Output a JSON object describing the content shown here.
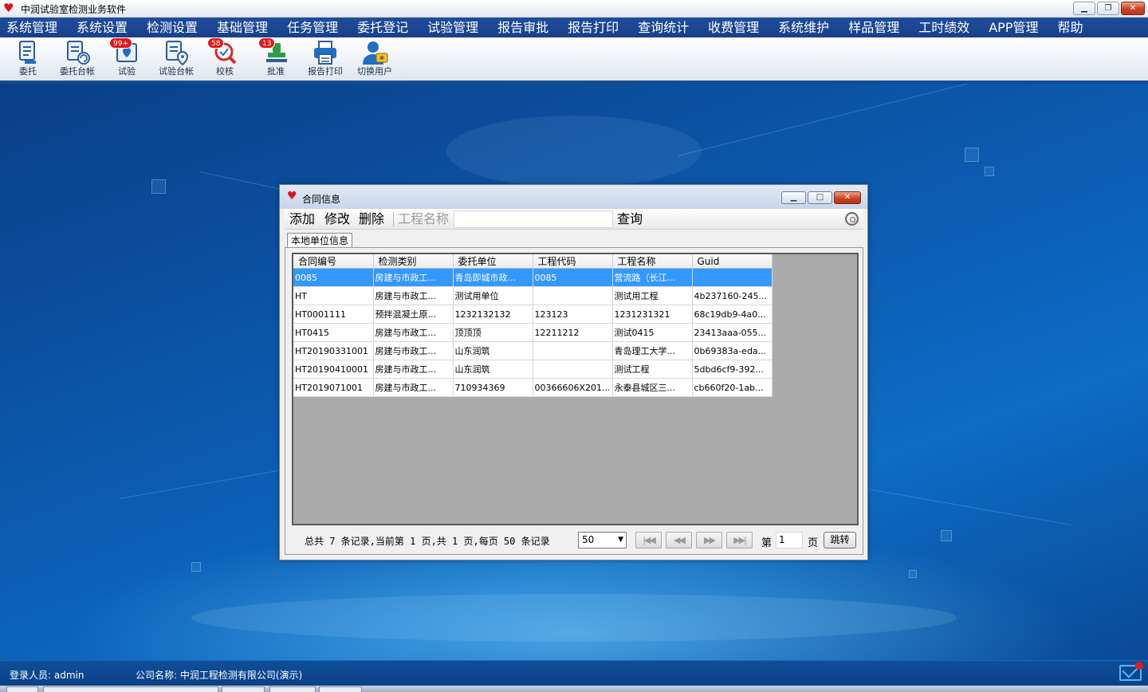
{
  "window": {
    "title": "中润试验室检测业务软件"
  },
  "menu": [
    "系统管理",
    "系统设置",
    "检测设置",
    "基础管理",
    "任务管理",
    "委托登记",
    "试验管理",
    "报告审批",
    "报告打印",
    "查询统计",
    "收费管理",
    "系统维护",
    "样品管理",
    "工时绩效",
    "APP管理",
    "帮助"
  ],
  "toolbar": {
    "items": [
      {
        "label": "委托",
        "icon": "document-icon"
      },
      {
        "label": "委托台帐",
        "icon": "document-refresh-icon"
      },
      {
        "label": "试验",
        "icon": "test-check-icon",
        "badge": "99+"
      },
      {
        "label": "试验台帐",
        "icon": "document-location-icon"
      },
      {
        "label": "校核",
        "icon": "magnifier-check-icon",
        "badge": "58"
      },
      {
        "label": "批准",
        "icon": "stamp-icon",
        "badge": "13"
      },
      {
        "label": "报告打印",
        "icon": "printer-icon"
      },
      {
        "label": "切换用户",
        "icon": "user-switch-icon"
      }
    ]
  },
  "dialog": {
    "title": "合同信息",
    "actions": {
      "add": "添加",
      "edit": "修改",
      "delete": "删除"
    },
    "search": {
      "label": "工程名称",
      "value": "",
      "button": "查询"
    },
    "tab": "本地单位信息",
    "columns": [
      "合同编号",
      "检测类别",
      "委托单位",
      "工程代码",
      "工程名称",
      "Guid"
    ],
    "rows": [
      [
        "0085",
        "房建与市政工...",
        "青岛即城市政...",
        "0085",
        "营流路（长江...",
        ""
      ],
      [
        "HT",
        "房建与市政工...",
        "测试用单位",
        "",
        "测试用工程",
        "4b237160-245..."
      ],
      [
        "HT0001111",
        "预拌混凝土原...",
        "1232132132",
        "123123",
        "1231231321",
        "68c19db9-4a0..."
      ],
      [
        "HT0415",
        "房建与市政工...",
        "顶顶顶",
        "12211212",
        "测试0415",
        "23413aaa-055..."
      ],
      [
        "HT20190331001",
        "房建与市政工...",
        "山东润筑",
        "",
        "青岛理工大学...",
        "0b69383a-eda..."
      ],
      [
        "HT20190410001",
        "房建与市政工...",
        "山东润筑",
        "",
        "测试工程",
        "5dbd6cf9-392..."
      ],
      [
        "HT2019071001",
        "房建与市政工...",
        "710934369",
        "00366606X201...",
        "永泰县城区三...",
        "cb660f20-1ab..."
      ]
    ],
    "selected_row": 0,
    "pager": {
      "summary": "总共 7 条记录,当前第 1 页,共 1 页,每页 50 条记录",
      "page_size": "50",
      "page_prefix": "第",
      "page_value": "1",
      "page_suffix": "页",
      "jump": "跳转"
    }
  },
  "status": {
    "user": "登录人员: admin",
    "company": "公司名称: 中润工程检测有限公司(演示)"
  }
}
